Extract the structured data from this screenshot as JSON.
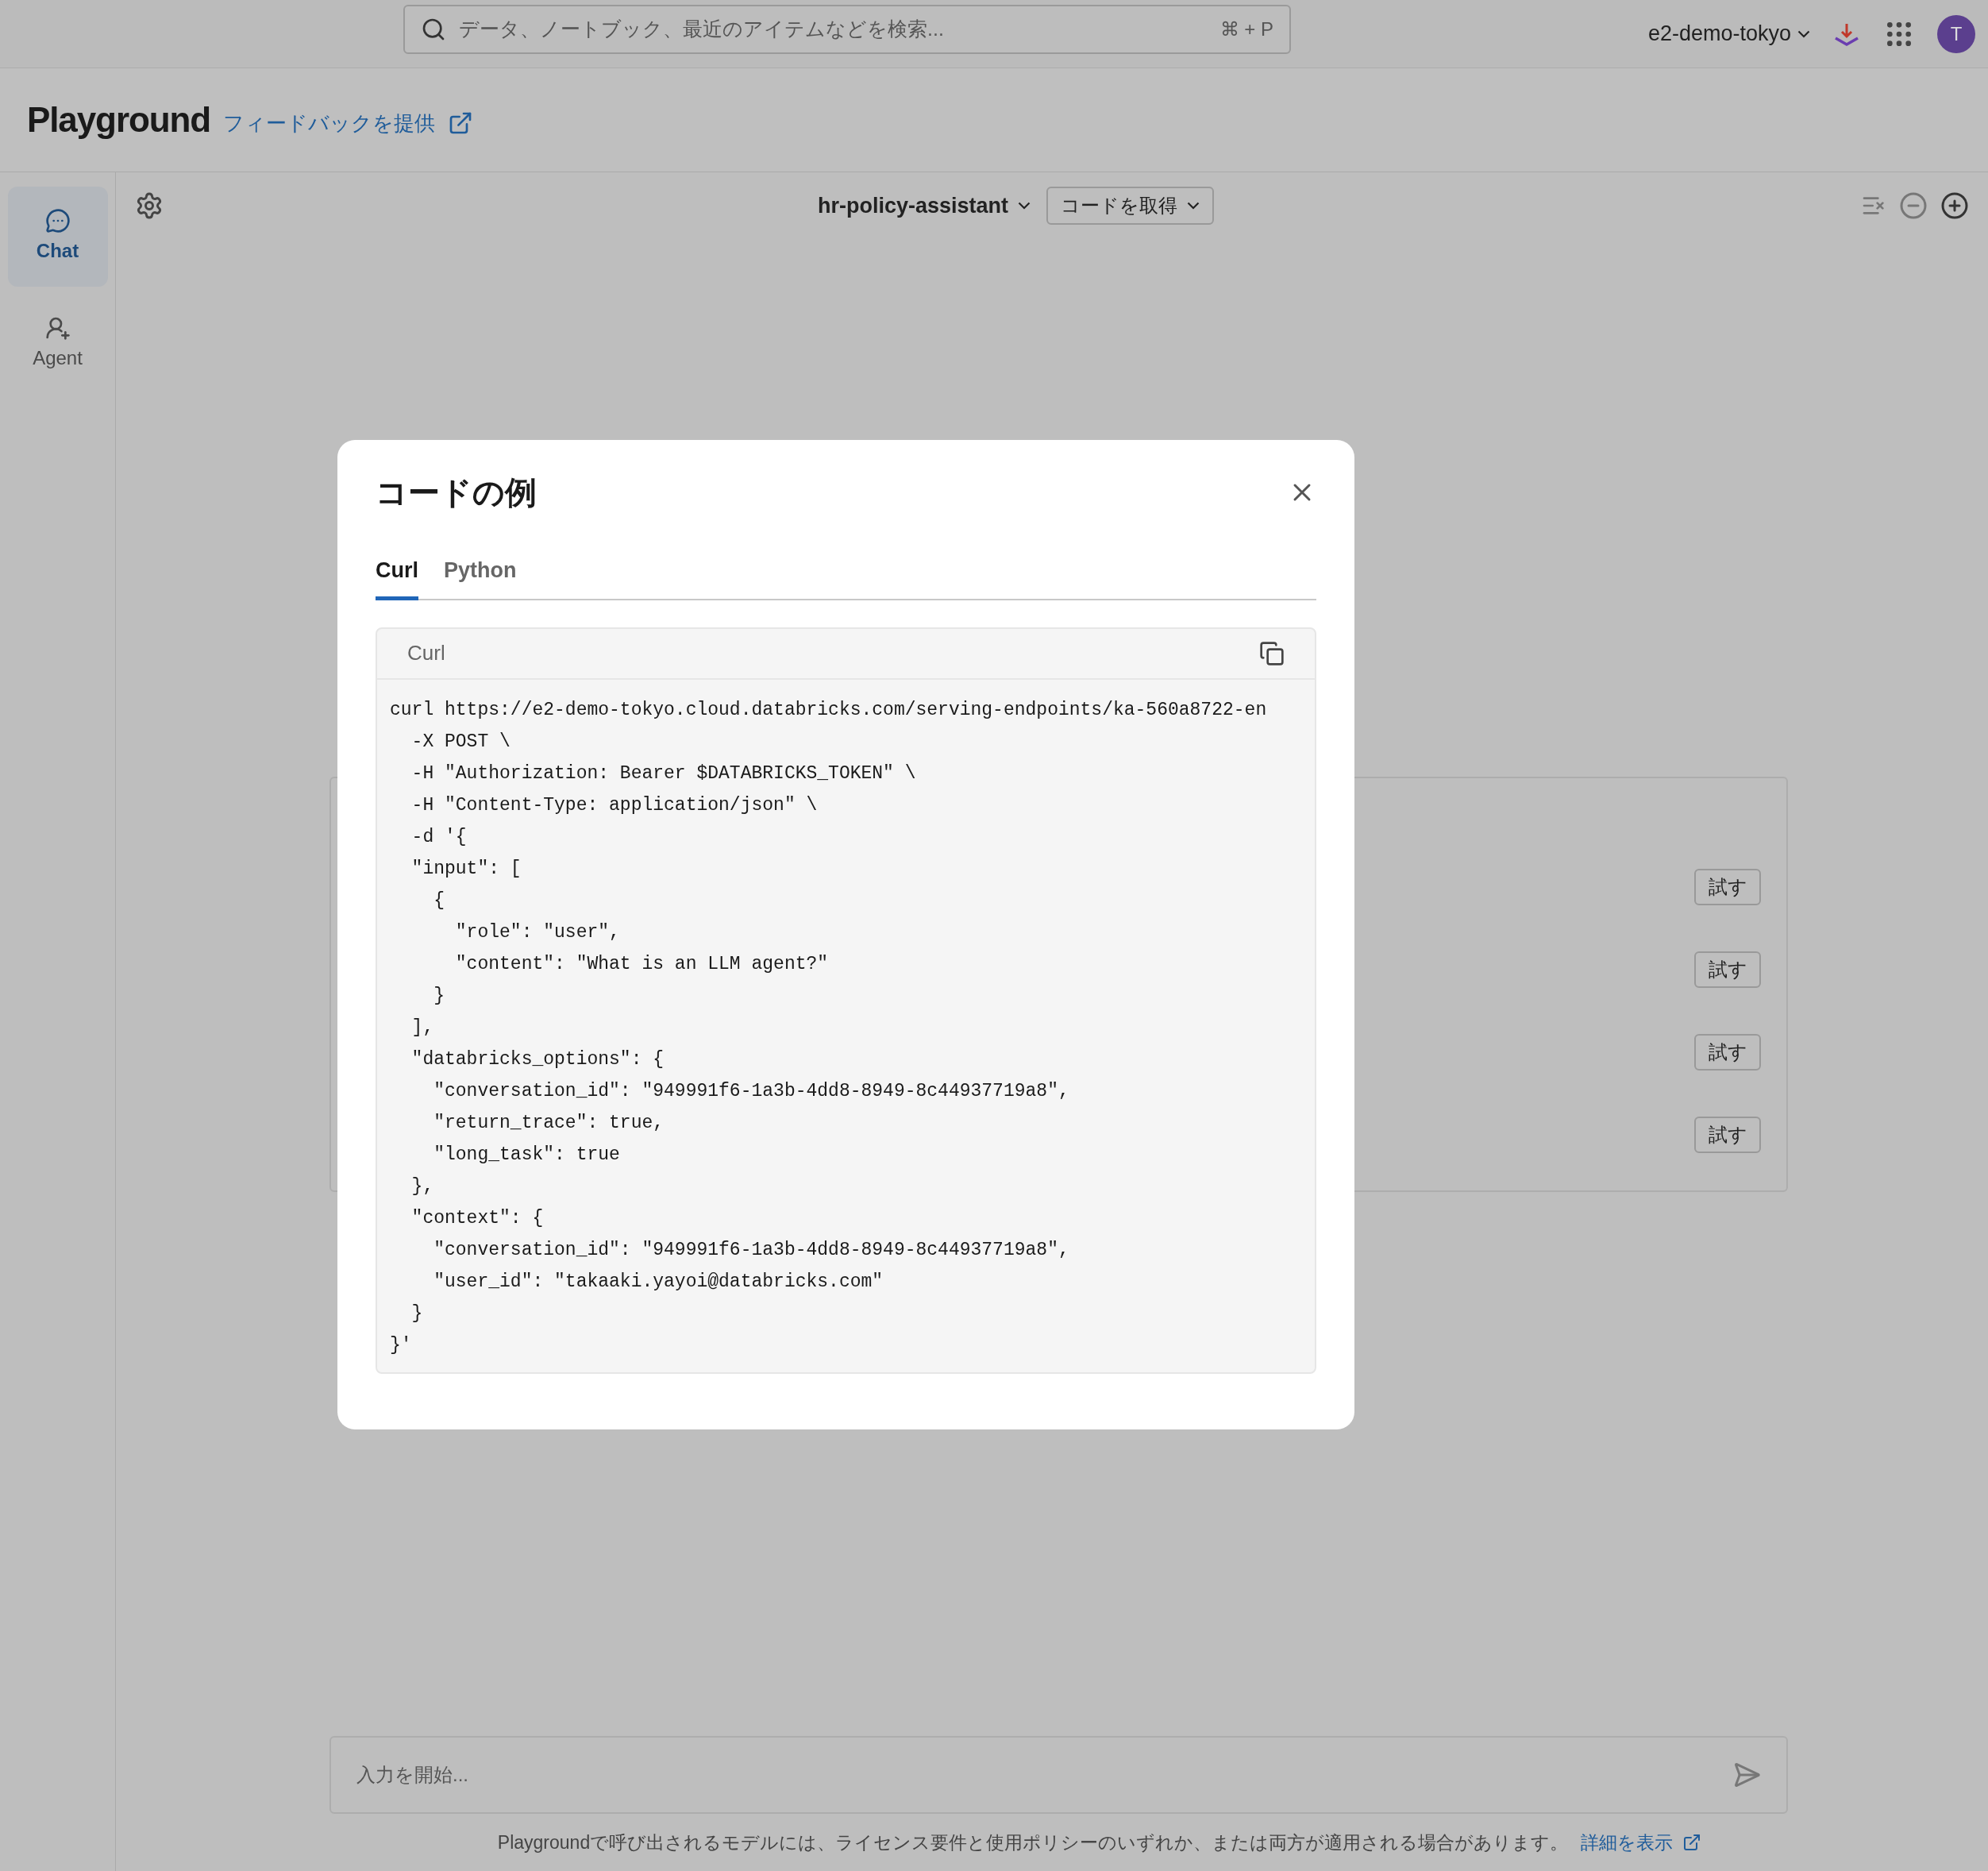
{
  "top_bar": {
    "search": {
      "placeholder": "データ、ノートブック、最近のアイテムなどを検索...",
      "shortcut": "⌘ + P"
    },
    "workspace": "e2-demo-tokyo",
    "avatar": "T"
  },
  "header": {
    "title": "Playground",
    "feedback_link": "フィードバックを提供"
  },
  "sidebar": {
    "items": [
      {
        "label": "Chat",
        "kind": "chat",
        "selected": true
      },
      {
        "label": "Agent",
        "kind": "agent",
        "selected": false
      }
    ]
  },
  "toolbar": {
    "model": "hr-policy-assistant",
    "code_button": "コードを取得"
  },
  "suggestions": [
    {
      "button": "試す"
    },
    {
      "button": "試す"
    },
    {
      "button": "試す"
    },
    {
      "button": "試す"
    }
  ],
  "chat_input": {
    "placeholder": "入力を開始..."
  },
  "footer": {
    "text": "Playgroundで呼び出されるモデルには、ライセンス要件と使用ポリシーのいずれか、または両方が適用される場合があります。",
    "link": "詳細を表示"
  },
  "modal": {
    "title": "コードの例",
    "tabs": [
      {
        "label": "Curl",
        "selected": true
      },
      {
        "label": "Python",
        "selected": false
      }
    ],
    "code_block": {
      "language": "Curl",
      "lines": [
        "curl https://e2-demo-tokyo.cloud.databricks.com/serving-endpoints/ka-560a8722-en",
        "  -X POST \\",
        "  -H \"Authorization: Bearer $DATABRICKS_TOKEN\" \\",
        "  -H \"Content-Type: application/json\" \\",
        "  -d '{",
        "  \"input\": [",
        "    {",
        "      \"role\": \"user\",",
        "      \"content\": \"What is an LLM agent?\"",
        "    }",
        "  ],",
        "  \"databricks_options\": {",
        "    \"conversation_id\": \"949991f6-1a3b-4dd8-8949-8c44937719a8\",",
        "    \"return_trace\": true,",
        "    \"long_task\": true",
        "  },",
        "  \"context\": {",
        "    \"conversation_id\": \"949991f6-1a3b-4dd8-8949-8c44937719a8\",",
        "    \"user_id\": \"takaaki.yayoi@databricks.com\"",
        "  }",
        "}'"
      ]
    }
  }
}
